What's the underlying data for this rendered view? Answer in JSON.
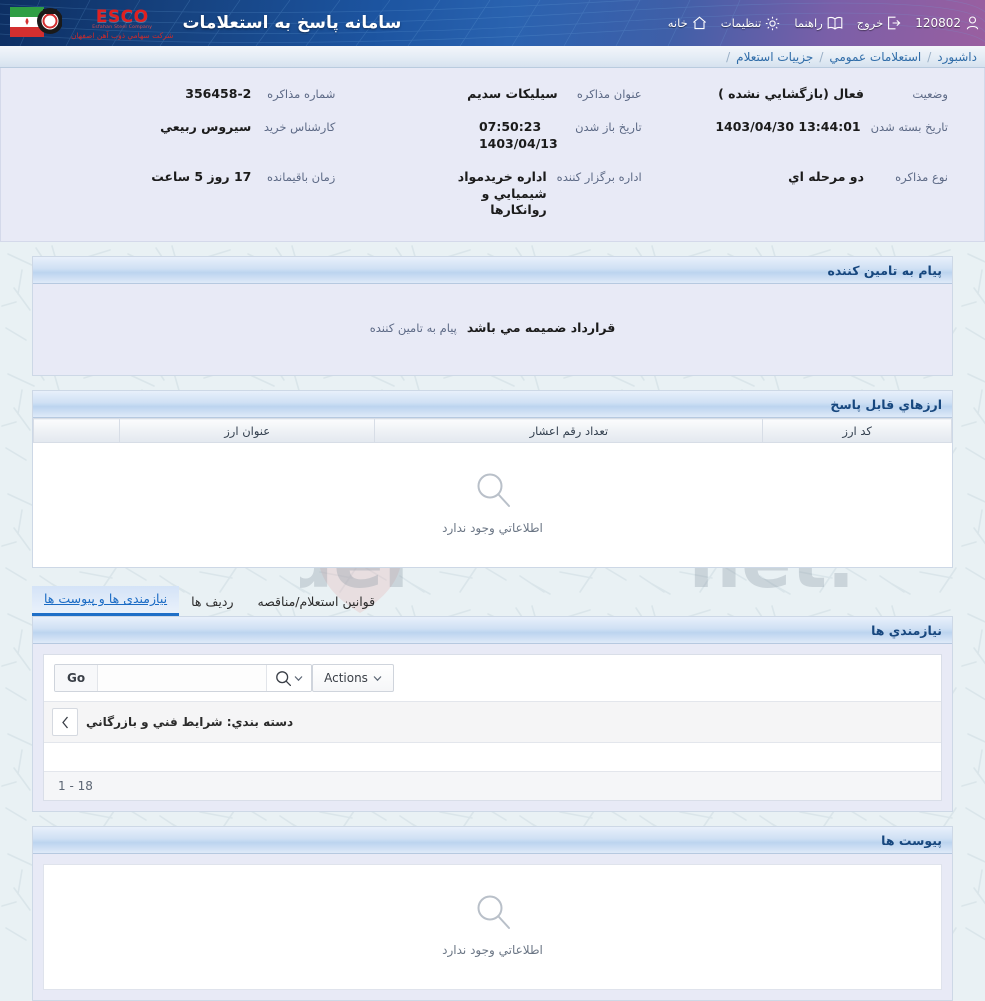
{
  "header": {
    "app_title": "سامانه پاسخ به استعلامات",
    "logo": {
      "esco_word": "ESCO",
      "esco_sub_en": "Esfahan Steel Company",
      "esco_sub_fa": "شرکت سهامي ذوب آهن اصفهان"
    },
    "nav": [
      {
        "label": "خانه",
        "icon": "home-icon"
      },
      {
        "label": "تنظیمات",
        "icon": "gear-icon"
      },
      {
        "label": "راهنما",
        "icon": "book-icon"
      },
      {
        "label": "خروج",
        "icon": "logout-icon"
      }
    ],
    "user_id": "120802"
  },
  "breadcrumb": {
    "items": [
      "داشبورد",
      "استعلامات عمومي",
      "جزییات استعلام"
    ],
    "separator": "/"
  },
  "info": {
    "rows": [
      [
        {
          "label": "شماره مذاکره",
          "value": "356458-2",
          "ltr": true
        },
        {
          "label": "عنوان مذاکره",
          "value": "سیلیکات سدیم",
          "ltr": false
        },
        {
          "label": "وضعیت",
          "value": "فعال (بازگشایي نشده )",
          "ltr": false
        }
      ],
      [
        {
          "label": "کارشناس خرید",
          "value": "سیروس ربیعي",
          "ltr": false
        },
        {
          "label": "تاریخ باز شدن",
          "value": "07:50:23\n1403/04/13",
          "ltr": true
        },
        {
          "label": "تاریخ بسته شدن",
          "value": "1403/04/30 13:44:01",
          "ltr": true
        }
      ],
      [
        {
          "label": "زمان باقیمانده",
          "value": "17 روز 5 ساعت",
          "ltr": false
        },
        {
          "label": "اداره برگزار کننده",
          "value": "اداره خریدمواد شیمیایي و روانکارها",
          "ltr": false
        },
        {
          "label": "نوع مذاکره",
          "value": "دو مرحله اي",
          "ltr": false
        }
      ]
    ]
  },
  "message_section": {
    "title": "پیام به تامین کننده",
    "label": "پیام به تامین کننده",
    "value": "قرارداد ضمیمه مي باشد"
  },
  "currency_section": {
    "title": "ارزهاي قابل پاسخ",
    "columns": [
      "کد ارز",
      "تعداد رقم اعشار",
      "عنوان ارز",
      ""
    ],
    "rows": [],
    "empty_text": "اطلاعاتي وجود ندارد",
    "empty_icon": "magnifier-icon"
  },
  "tabs": [
    {
      "label": "نیازمندی ها و پیوست ها",
      "active": true
    },
    {
      "label": "ردیف ها",
      "active": false
    },
    {
      "label": "قوانین استعلام/مناقصه",
      "active": false
    }
  ],
  "requirements_section": {
    "title": "نیازمندي ها",
    "toolbar": {
      "search_placeholder": "",
      "search_value": "",
      "go_label": "Go",
      "actions_label": "Actions",
      "search_icon": "magnifier-icon",
      "chevron_icon": "chevron-down-icon"
    },
    "group": {
      "label": "دسته بندي: شرایط فني و بازرگاني",
      "collapse_icon": "chevron-left-icon"
    },
    "pager": "1 - 18"
  },
  "attachments_section": {
    "title": "پیوست ها",
    "empty_text": "اطلاعاتي وجود ندارد",
    "empty_icon": "magnifier-icon"
  },
  "watermark": {
    "text_a": "AriaTender",
    "text_b": ".net"
  },
  "colors": {
    "header_blue": "#1c54a0",
    "accent_link": "#2f6ca8",
    "panel_bg": "#e8eaf6",
    "page_bg": "#e9f1f4",
    "tab_active": "#1f6fc7",
    "brand_red": "#e02020"
  }
}
